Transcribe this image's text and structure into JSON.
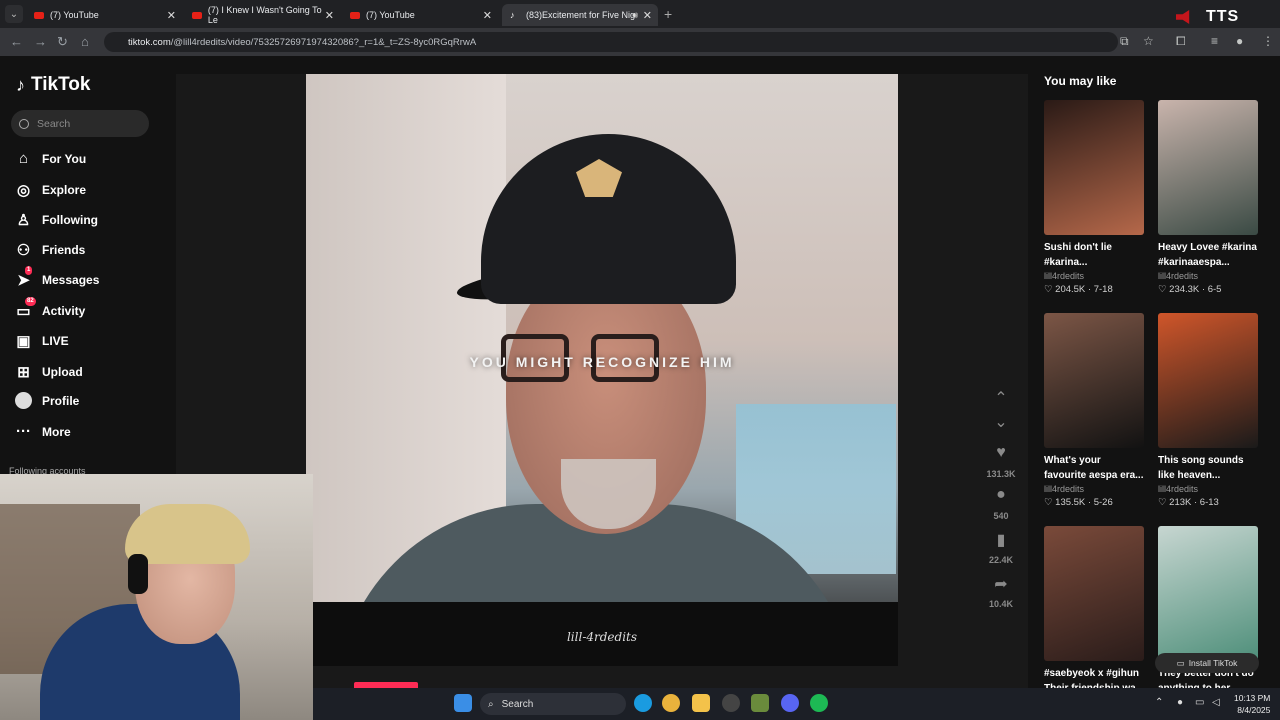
{
  "browser": {
    "tabs": [
      {
        "title": "(7) YouTube",
        "active": false
      },
      {
        "title": "(7) I Knew I Wasn't Going To Le",
        "active": false
      },
      {
        "title": "(7) YouTube",
        "active": false
      },
      {
        "title": "(83)Excitement for Five Nig",
        "active": true
      }
    ],
    "url_host": "tiktok.com",
    "url_path": "/@lill4rdedits/video/7532572697197432086?_r=1&_t=ZS-8yc0RGqRrwA",
    "tts_label": "TTS"
  },
  "tiktok": {
    "logo_text": "TikTok",
    "search_placeholder": "Search",
    "nav": [
      {
        "label": "For You",
        "icon": "home-icon",
        "glyph": "⌂"
      },
      {
        "label": "Explore",
        "icon": "compass-icon",
        "glyph": "◎"
      },
      {
        "label": "Following",
        "icon": "following-icon",
        "glyph": "♙"
      },
      {
        "label": "Friends",
        "icon": "friends-icon",
        "glyph": "⚇"
      },
      {
        "label": "Messages",
        "icon": "messages-icon",
        "glyph": "➤",
        "badge": "1"
      },
      {
        "label": "Activity",
        "icon": "activity-icon",
        "glyph": "▭",
        "badge": "82"
      },
      {
        "label": "LIVE",
        "icon": "live-icon",
        "glyph": "▣"
      },
      {
        "label": "Upload",
        "icon": "upload-icon",
        "glyph": "⊞"
      },
      {
        "label": "Profile",
        "icon": "profile-icon",
        "glyph": ""
      },
      {
        "label": "More",
        "icon": "more-icon",
        "glyph": "···"
      }
    ],
    "following_accounts_label": "Following accounts",
    "video": {
      "caption": "YOU MIGHT RECOGNIZE HIM",
      "watermark": "lill-4rdedits"
    },
    "actions": {
      "likes": "131.3K",
      "comments": "540",
      "saves": "22.4K",
      "shares": "10.4K"
    },
    "you_may_like_title": "You may like",
    "suggested": [
      {
        "title_l1": "Sushi don't lie",
        "title_l2": "#karina...",
        "author": "lill4rdedits",
        "likes": "204.5K",
        "date": "7-18",
        "tone": [
          "#b5684a",
          "#2a1a16"
        ]
      },
      {
        "title_l1": "Heavy Lovee #karina",
        "title_l2": "#karinaaespa...",
        "author": "lill4rdedits",
        "likes": "234.3K",
        "date": "6-5",
        "tone": [
          "#3a4a44",
          "#c9b4ac"
        ]
      },
      {
        "title_l1": "What's your",
        "title_l2": "favourite aespa era...",
        "author": "lill4rdedits",
        "likes": "135.5K",
        "date": "5-26",
        "tone": [
          "#121212",
          "#7c5646"
        ]
      },
      {
        "title_l1": "This song sounds",
        "title_l2": "like heaven...",
        "author": "lill4rdedits",
        "likes": "213K",
        "date": "6-13",
        "tone": [
          "#1a1a1a",
          "#d0562a"
        ]
      },
      {
        "title_l1": "#saebyeok x #gihun",
        "title_l2": "Their friendship wa...",
        "author": "",
        "likes": "",
        "date": "",
        "tone": [
          "#2a1c1a",
          "#7a4a3a"
        ]
      },
      {
        "title_l1": "They better don't do",
        "title_l2": "anything to her...",
        "author": "",
        "likes": "",
        "date": "",
        "tone": [
          "#4e8f7a",
          "#c7d6d1"
        ]
      }
    ],
    "install_label": "Install TikTok"
  },
  "taskbar": {
    "search_label": "Search",
    "time": "10:13 PM",
    "date": "8/4/2025"
  }
}
